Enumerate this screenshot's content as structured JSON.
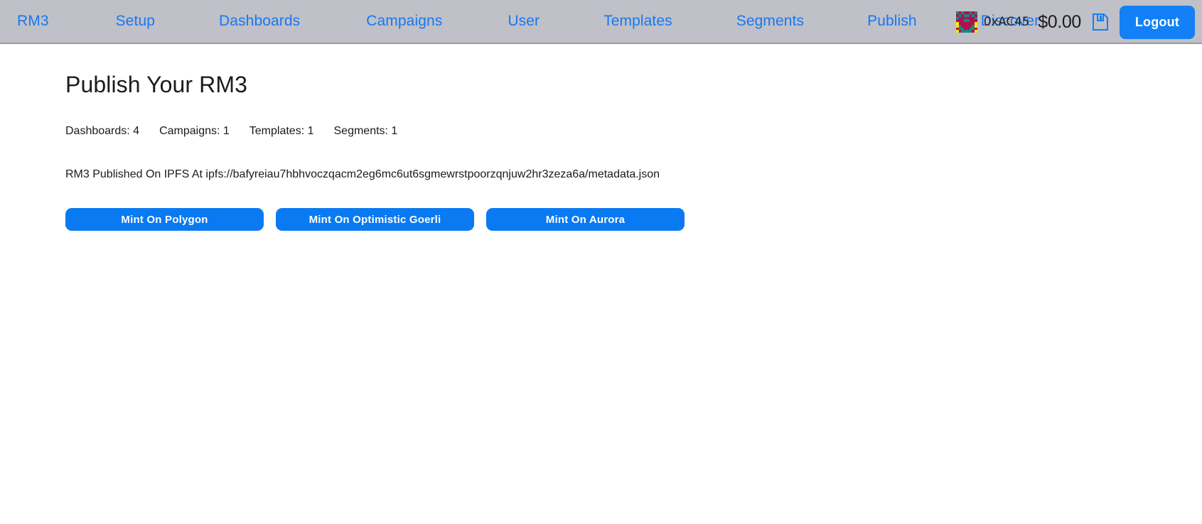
{
  "navbar": {
    "links": [
      {
        "label": "RM3"
      },
      {
        "label": "Setup"
      },
      {
        "label": "Dashboards"
      },
      {
        "label": "Campaigns"
      },
      {
        "label": "User"
      },
      {
        "label": "Templates"
      },
      {
        "label": "Segments"
      },
      {
        "label": "Publish"
      },
      {
        "label": "Discover"
      }
    ],
    "wallet": {
      "avatar_icon": "blockie-identicon",
      "avatar_colors": {
        "background": "#168a84",
        "foreground": "#b01050",
        "spot": "#f2e818"
      },
      "avatar_grid": [
        [
          "bg",
          "fg",
          "bg",
          "fg",
          "fg",
          "bg",
          "fg",
          "bg"
        ],
        [
          "fg",
          "bg",
          "fg",
          "bg",
          "bg",
          "fg",
          "bg",
          "fg"
        ],
        [
          "bg",
          "fg",
          "fg",
          "fg",
          "fg",
          "fg",
          "fg",
          "bg"
        ],
        [
          "fg",
          "fg",
          "fg",
          "bg",
          "bg",
          "fg",
          "fg",
          "fg"
        ],
        [
          "sp",
          "fg",
          "fg",
          "fg",
          "fg",
          "fg",
          "fg",
          "sp"
        ],
        [
          "sp",
          "bg",
          "fg",
          "fg",
          "fg",
          "fg",
          "bg",
          "sp"
        ],
        [
          "fg",
          "bg",
          "bg",
          "fg",
          "fg",
          "bg",
          "bg",
          "fg"
        ],
        [
          "sp",
          "fg",
          "bg",
          "bg",
          "bg",
          "bg",
          "fg",
          "sp"
        ]
      ],
      "address": "0xAC45",
      "balance": "$0.00"
    },
    "save_icon": "floppy-save-icon",
    "logout_label": "Logout",
    "accent_color": "#1380f5",
    "link_color": "#1878f0",
    "bar_color": "#bfc0c8"
  },
  "main": {
    "title": "Publish Your RM3",
    "stats": [
      {
        "label": "Dashboards: 4"
      },
      {
        "label": "Campaigns: 1"
      },
      {
        "label": "Templates: 1"
      },
      {
        "label": "Segments: 1"
      }
    ],
    "ipfs_status": "RM3 Published On IPFS At ipfs://bafyreiau7hbhvoczqacm2eg6mc6ut6sgmewrstpoorzqnjuw2hr3zeza6a/metadata.json",
    "mint_buttons": [
      {
        "label": "Mint On Polygon"
      },
      {
        "label": "Mint On Optimistic Goerli"
      },
      {
        "label": "Mint On Aurora"
      }
    ],
    "button_color": "#097af2"
  }
}
